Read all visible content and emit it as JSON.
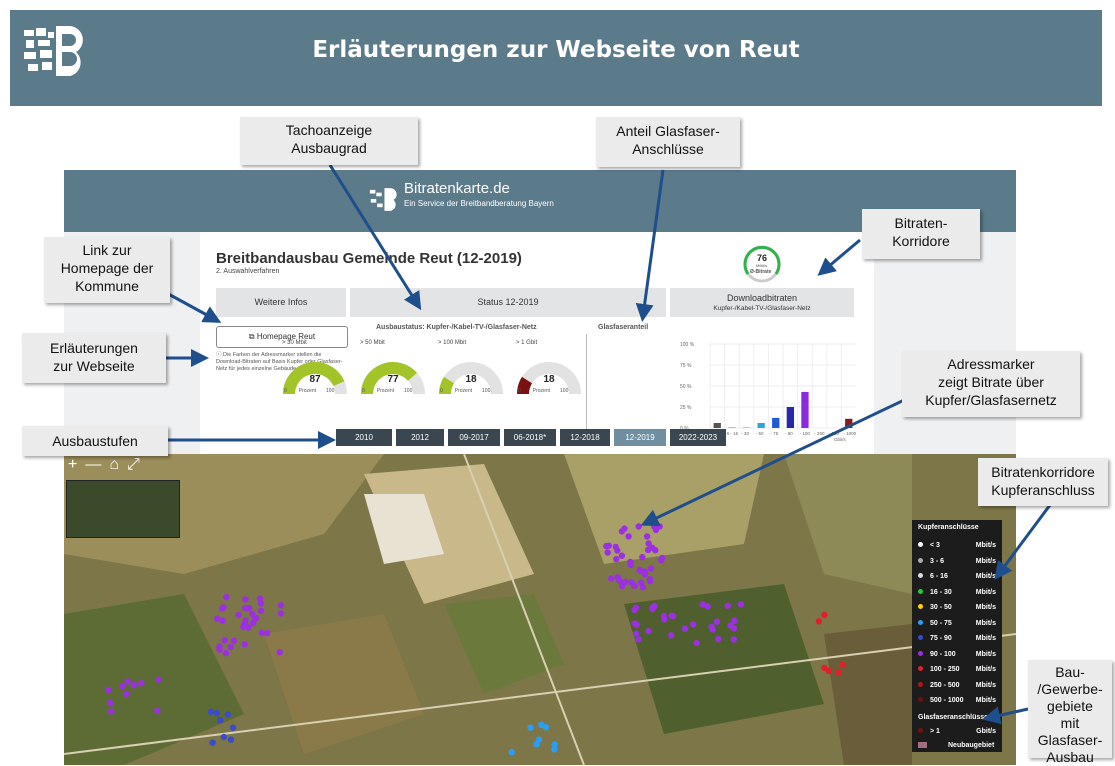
{
  "header": {
    "title": "Erläuterungen zur Webseite von Reut"
  },
  "site": {
    "brand_name": "Bitratenkarte.de",
    "brand_sub": "Ein Service der Breitbandberatung Bayern",
    "page_title": "Breitbandausbau Gemeinde Reut (12-2019)",
    "page_sub": "2. Auswahlverfahren",
    "tabs": {
      "infos": "Weitere Infos",
      "status": "Status 12-2019",
      "download": "Downloadbitraten",
      "download_sub": "Kupfer-/Kabel-TV-/Glasfaser-Netz"
    },
    "gauge_avg": {
      "value": "76",
      "unit": "MBit/s",
      "label": "Ø-Bitrate"
    },
    "homepage_button": "Homepage Reut",
    "note": "Die Farben der Adressmarker stellen die Download-Bitraten auf Basis Kupfer oder Glasfaser-Netz für jedes einzelne Gebäude dar.",
    "ausbau_header": "Ausbaustatus: Kupfer-/Kabel-TV-/Glasfaser-Netz",
    "glas_header": "Glasfaseranteil",
    "gauges": [
      {
        "cap": "> 30 Mbit",
        "value": 87,
        "color": "#a3c428"
      },
      {
        "cap": "> 50 Mbit",
        "value": 77,
        "color": "#a3c428"
      },
      {
        "cap": "> 100 Mbit",
        "value": 18,
        "color": "#a3c428"
      },
      {
        "cap": "> 1 Gbit",
        "value": 18,
        "color": "#7a1010"
      }
    ],
    "gauge_min": "0",
    "gauge_max": "100",
    "gauge_unit": "Prozent",
    "bar_chart": {
      "yticks": [
        "100 %",
        "75 %",
        "50 %",
        "25 %",
        "0 %"
      ],
      "xlabels": [
        "< 6",
        "6 - 16",
        "- 30",
        "- 50",
        "- 75",
        "- 90",
        "- 100",
        "- 250",
        "- 500",
        "- 1000"
      ],
      "xunit": "Gbit/s",
      "values": [
        6,
        1,
        1,
        6,
        12,
        25,
        43,
        0,
        0,
        11
      ],
      "colors": [
        "#555555",
        "#9acd32",
        "#cccc33",
        "#2aa6d9",
        "#1e5bd6",
        "#2828aa",
        "#8a2be2",
        "#ffffff",
        "#ffffff",
        "#8b1a1a"
      ]
    },
    "years": [
      "2010",
      "2012",
      "09-2017",
      "06-2018*",
      "12-2018",
      "12-2019",
      "2022-2023"
    ],
    "active_year": "12-2019",
    "map_controls": [
      "+",
      "—",
      "⌂",
      "⤢"
    ],
    "legend": {
      "title": "Kupferanschlüsse",
      "rows": [
        {
          "range": "< 3",
          "unit": "Mbit/s",
          "color": "#ffffff"
        },
        {
          "range": "3 - 6",
          "unit": "Mbit/s",
          "color": "#aaaaaa"
        },
        {
          "range": "6 - 16",
          "unit": "Mbit/s",
          "color": "#dddddd"
        },
        {
          "range": "16 - 30",
          "unit": "Mbit/s",
          "color": "#27c93f"
        },
        {
          "range": "30 - 50",
          "unit": "Mbit/s",
          "color": "#ffd400"
        },
        {
          "range": "50 - 75",
          "unit": "Mbit/s",
          "color": "#2a9df4"
        },
        {
          "range": "75 - 90",
          "unit": "Mbit/s",
          "color": "#3b4cc9"
        },
        {
          "range": "90 - 100",
          "unit": "Mbit/s",
          "color": "#9b30e0"
        },
        {
          "range": "100 - 250",
          "unit": "Mbit/s",
          "color": "#e0202a"
        },
        {
          "range": "250 - 500",
          "unit": "Mbit/s",
          "color": "#b01818"
        },
        {
          "range": "500 - 1000",
          "unit": "Mbit/s",
          "color": "#701010"
        }
      ],
      "glas_title": "Glasfaseranschlüsse",
      "glas_row": {
        "range": "> 1",
        "unit": "Gbit/s",
        "color": "#701010"
      },
      "new_area": "Neubaugebiet"
    }
  },
  "callouts": {
    "tacho": [
      "Tachoanzeige",
      "Ausbaugrad"
    ],
    "glas": [
      "Anteil Glasfaser-",
      "Anschlüsse"
    ],
    "korridore": [
      "Bitraten-",
      "Korridore"
    ],
    "link": [
      "Link zur",
      "Homepage der",
      "Kommune"
    ],
    "erl": [
      "Erläuterungen",
      "zur Webseite"
    ],
    "adress": [
      "Adressmarker",
      "zeigt Bitrate über",
      "Kupfer/Glasfasernetz"
    ],
    "stufen": [
      "Ausbaustufen"
    ],
    "kupfer": [
      "Bitratenkorridore",
      "Kupferanschluss"
    ],
    "bau": [
      "Bau-",
      "/Gewerbe-",
      "gebiete",
      "mit Glasfaser-",
      "Ausbau"
    ]
  }
}
